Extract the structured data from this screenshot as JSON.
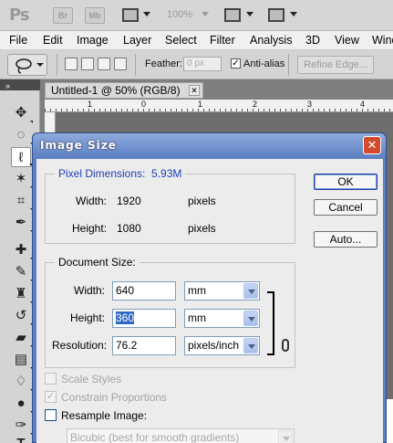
{
  "app": {
    "logo": "Ps",
    "bridge_label": "Br",
    "minibridge_label": "Mb",
    "zoom": "100%"
  },
  "menu": [
    "File",
    "Edit",
    "Image",
    "Layer",
    "Select",
    "Filter",
    "Analysis",
    "3D",
    "View",
    "Wind"
  ],
  "options": {
    "feather_label": "Feather:",
    "feather_value": "0 px",
    "antialias_label": "Anti-alias",
    "refine_edge": "Refine Edge..."
  },
  "document": {
    "tab_title": "Untitled-1 @ 50% (RGB/8)",
    "ruler_ticks": [
      "1",
      "0",
      "1",
      "2",
      "3",
      "4"
    ]
  },
  "dialog": {
    "title": "Image Size",
    "pixel_dimensions": {
      "legend": "Pixel Dimensions:",
      "size": "5.93M",
      "width_label": "Width:",
      "width_value": "1920",
      "width_unit": "pixels",
      "height_label": "Height:",
      "height_value": "1080",
      "height_unit": "pixels"
    },
    "document_size": {
      "legend": "Document Size:",
      "width_label": "Width:",
      "width_value": "640",
      "width_unit": "mm",
      "height_label": "Height:",
      "height_value": "360",
      "height_unit": "mm",
      "resolution_label": "Resolution:",
      "resolution_value": "76.2",
      "resolution_unit": "pixels/inch"
    },
    "options": {
      "scale_styles": "Scale Styles",
      "constrain": "Constrain Proportions",
      "resample": "Resample Image:",
      "resample_method": "Bicubic (best for smooth gradients)"
    },
    "buttons": {
      "ok": "OK",
      "cancel": "Cancel",
      "auto": "Auto..."
    }
  },
  "colors": {
    "title_bar": "#5d7fc3",
    "close_button": "#d44b2c",
    "selection": "#316ac5",
    "legend_blue": "#1f3fb8"
  }
}
